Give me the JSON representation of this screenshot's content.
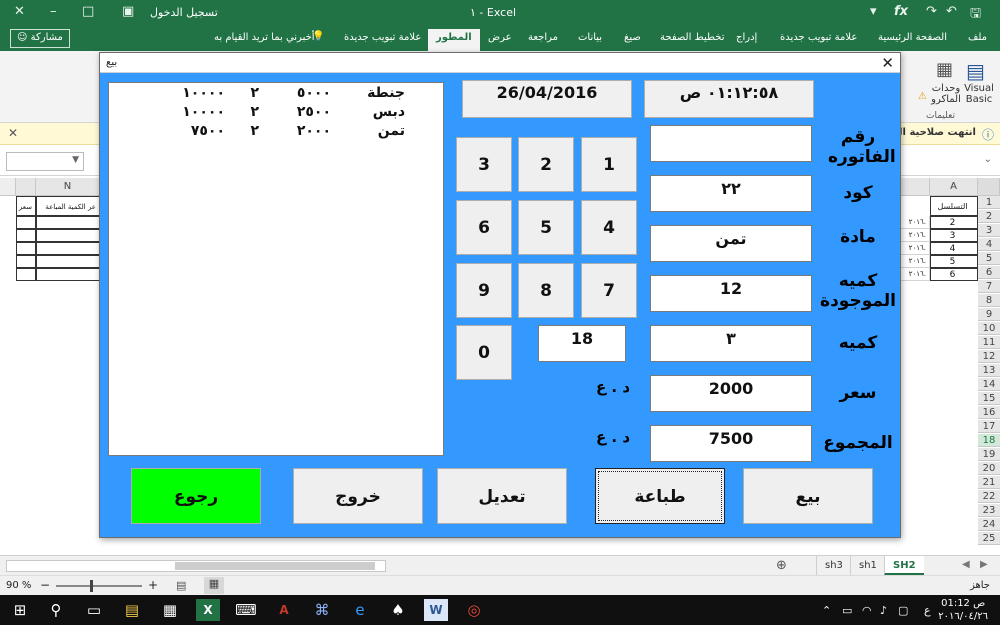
{
  "window": {
    "title": "١ - Excel",
    "signin": "تسجيل الدخول"
  },
  "ribbon": {
    "share": "مشاركة",
    "tellme": "أخبرني بما تريد القيام به",
    "tabs": [
      "ملف",
      "الصفحة الرئيسية",
      "علامة تبويب جديدة",
      "إدراج",
      "تخطيط الصفحة",
      "صيغ",
      "بيانات",
      "مراجعة",
      "عرض",
      "المطور",
      "علامة تبويب جديدة"
    ],
    "active_tab": "المطور",
    "group_visual_basic": "Visual Basic",
    "group_macros": "وحدات الماكرو",
    "group_code": "تعليمات"
  },
  "infobar": {
    "text": "انتهت صلاحية ال"
  },
  "grid": {
    "col_a": "A",
    "col_n": "N",
    "hdr_serial": "التسلسل",
    "hdr_qty_sold": "عر الكمية المباعة",
    "hdr_price": "سعر",
    "a_values": [
      "2",
      "3",
      "4",
      "5",
      "6"
    ],
    "b_values": [
      "٢٠١٦.",
      "٢٠١٦.",
      "٢٠١٦.",
      "٢٠١٦.",
      "٢٠١٦."
    ],
    "rows": [
      "1",
      "2",
      "3",
      "4",
      "5",
      "6",
      "7",
      "8",
      "9",
      "10",
      "11",
      "12",
      "13",
      "14",
      "15",
      "16",
      "17",
      "18",
      "19",
      "20",
      "21",
      "22",
      "23",
      "24",
      "25"
    ],
    "selected_row": "18"
  },
  "sheets": {
    "tabs": [
      "SH2",
      "sh1",
      "sh3"
    ],
    "active": "SH2"
  },
  "status": {
    "ready": "جاهز",
    "zoom": "90 %"
  },
  "taskbar": {
    "time": "01:12 ص",
    "date": "٢٠١٦/٠٤/٢٦",
    "lang": "ع"
  },
  "dialog": {
    "title": "بيع",
    "date": "26/04/2016",
    "time": "٠١:١٢:٥٨ ص",
    "labels": {
      "invoice": "رقم الفاتوره",
      "code": "كود",
      "item": "مادة",
      "stock": "كميه الموجودة",
      "qty": "كميه",
      "price": "سعر",
      "total": "المجموع"
    },
    "fields": {
      "invoice": "",
      "code": "٢٢",
      "item": "تمن",
      "stock": "12",
      "qty": "٣",
      "price": "2000",
      "total": "7500"
    },
    "currency_price": "د . ع",
    "currency_total": "د . ع",
    "keypad": [
      "1",
      "2",
      "3",
      "4",
      "5",
      "6",
      "7",
      "8",
      "9",
      "0"
    ],
    "keypad_display": "18",
    "list": [
      {
        "name": "جنطة",
        "price": "٥٠٠٠",
        "qty": "٢",
        "total": "١٠٠٠٠"
      },
      {
        "name": "دبس",
        "price": "٢٥٠٠",
        "qty": "٢",
        "total": "١٠٠٠٠"
      },
      {
        "name": "تمن",
        "price": "٢٠٠٠",
        "qty": "٢",
        "total": "٧٥٠٠"
      }
    ],
    "buttons": {
      "sell": "بيع",
      "print": "طباعة",
      "edit": "تعديل",
      "exit": "خروج",
      "return": "رجوع"
    },
    "return_color": "#00ff00"
  }
}
